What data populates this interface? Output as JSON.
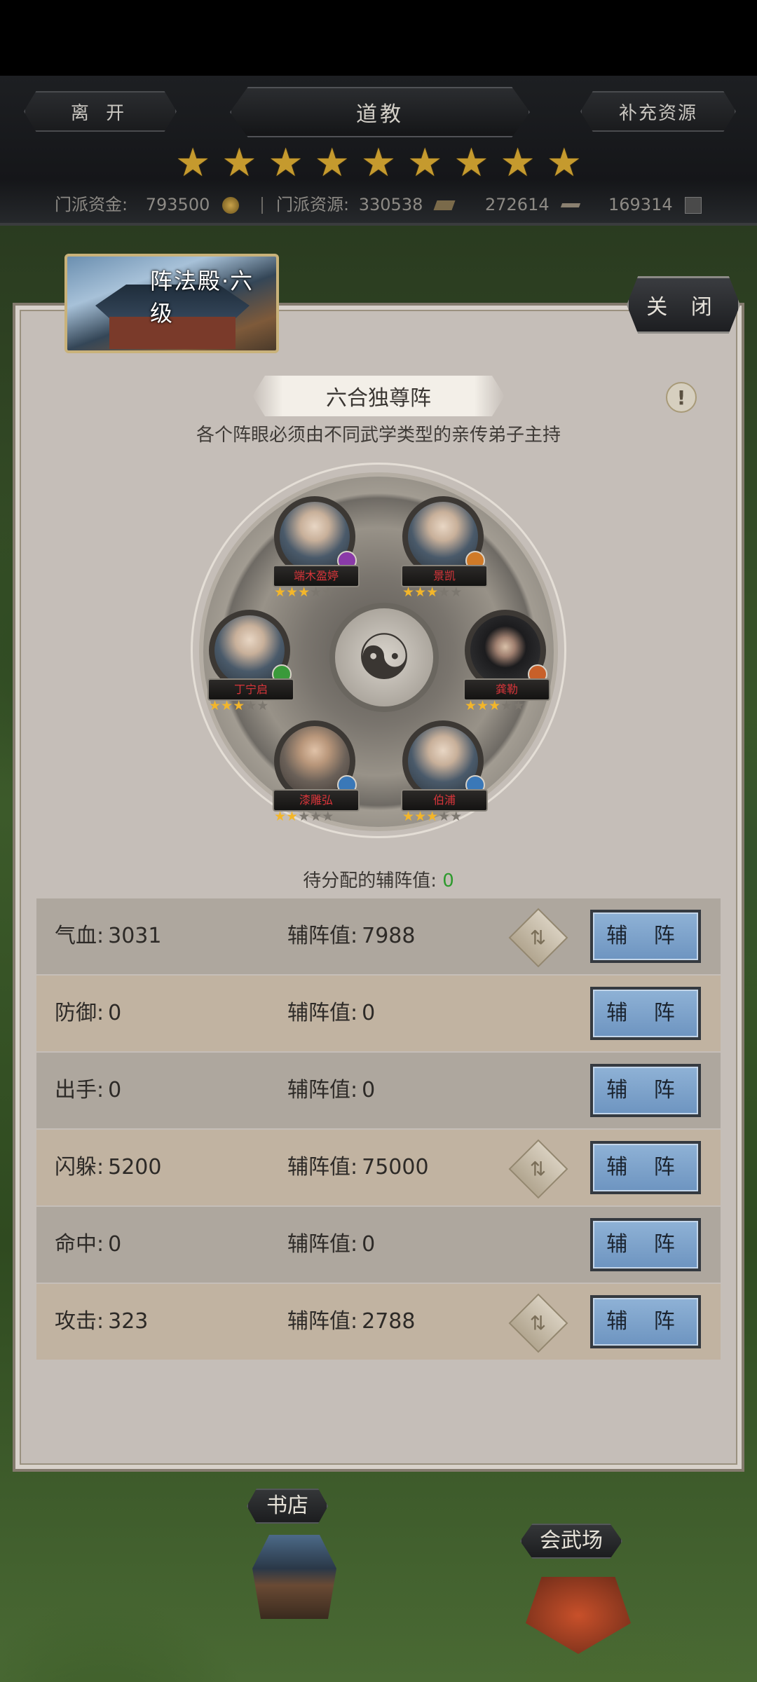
{
  "header": {
    "leave_label": "离 开",
    "title": "道教",
    "replenish_label": "补充资源",
    "stars_count": 9,
    "resources": [
      {
        "label": "门派资金:",
        "value": "793500",
        "icon": "coin-icon"
      },
      {
        "label": "门派资源:",
        "value": "330538",
        "icon": "ingot-icon"
      },
      {
        "label": "",
        "value": "272614",
        "icon": "sword-icon"
      },
      {
        "label": "",
        "value": "169314",
        "icon": "crate-icon"
      }
    ]
  },
  "dialog": {
    "hall_title": "阵法殿·六级",
    "close_label": "关 闭",
    "formation_name": "六合独尊阵",
    "info_icon": "!",
    "subtitle": "各个阵眼必须由不同武学类型的亲传弟子主持",
    "pending_label": "待分配的辅阵值:",
    "pending_value": "0",
    "center_symbol": "☯"
  },
  "disciples": [
    {
      "name": "端木盈婷",
      "stars": 3,
      "max_stars": 5,
      "badge_color": "#8a3aa8"
    },
    {
      "name": "景凯",
      "stars": 3,
      "max_stars": 5,
      "badge_color": "#d07a28"
    },
    {
      "name": "丁宁启",
      "stars": 3,
      "max_stars": 5,
      "badge_color": "#3a9a3a"
    },
    {
      "name": "龚勒",
      "stars": 3,
      "max_stars": 5,
      "badge_color": "#c8602a"
    },
    {
      "name": "漆雕弘",
      "stars": 2,
      "max_stars": 5,
      "badge_color": "#3a78b8"
    },
    {
      "name": "伯浦",
      "stars": 3,
      "max_stars": 5,
      "badge_color": "#3a78b8"
    }
  ],
  "attributes": [
    {
      "label": "气血:",
      "value": "3031",
      "sub_label": "辅阵值:",
      "sub_value": "7988",
      "has_swap": true,
      "button": "辅 阵"
    },
    {
      "label": "防御:",
      "value": "0",
      "sub_label": "辅阵值:",
      "sub_value": "0",
      "has_swap": false,
      "button": "辅 阵"
    },
    {
      "label": "出手:",
      "value": "0",
      "sub_label": "辅阵值:",
      "sub_value": "0",
      "has_swap": false,
      "button": "辅 阵"
    },
    {
      "label": "闪躲:",
      "value": "5200",
      "sub_label": "辅阵值:",
      "sub_value": "75000",
      "has_swap": true,
      "button": "辅 阵"
    },
    {
      "label": "命中:",
      "value": "0",
      "sub_label": "辅阵值:",
      "sub_value": "0",
      "has_swap": false,
      "button": "辅 阵"
    },
    {
      "label": "攻击:",
      "value": "323",
      "sub_label": "辅阵值:",
      "sub_value": "2788",
      "has_swap": true,
      "button": "辅 阵"
    }
  ],
  "map": {
    "bookstore_label": "书店",
    "arena_label": "会武场"
  },
  "colors": {
    "accent_star": "#c59a2e",
    "button_blue": "#7aa0c8",
    "pending_green": "#2e9a2e",
    "name_red": "#d8353a"
  }
}
